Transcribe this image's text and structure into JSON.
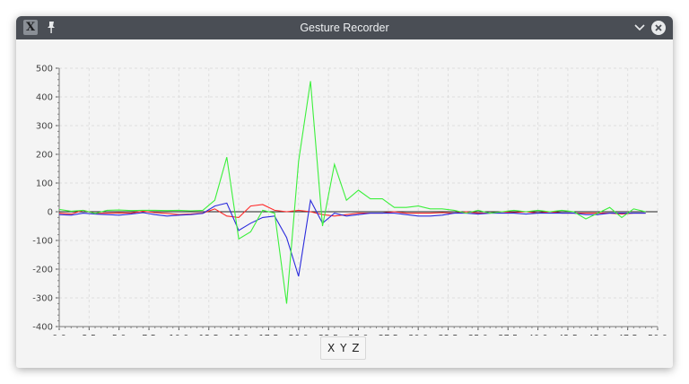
{
  "window": {
    "title": "Gesture Recorder"
  },
  "titlebar_icons": [
    "app-icon",
    "pin-icon",
    "chevron-down-icon",
    "close-icon"
  ],
  "legend": {
    "items": [
      "X",
      "Y",
      "Z"
    ]
  },
  "chart_data": {
    "type": "line",
    "xlim": [
      0,
      50
    ],
    "ylim": [
      -400,
      500
    ],
    "xticks": [
      "0.0",
      "2.5",
      "5.0",
      "7.5",
      "10.0",
      "12.5",
      "15.0",
      "17.5",
      "20.0",
      "22.5",
      "25.0",
      "27.5",
      "30.0",
      "32.5",
      "35.0",
      "37.5",
      "40.0",
      "42.5",
      "45.0",
      "47.5",
      "50.0"
    ],
    "yticks": [
      "500",
      "400",
      "300",
      "200",
      "100",
      "0",
      "-100",
      "-200",
      "-300",
      "-400"
    ],
    "grid": true,
    "series": [
      {
        "name": "X",
        "color": "#ff2a2a",
        "x": [
          0,
          1,
          2,
          3,
          4,
          5,
          6,
          7,
          8,
          9,
          10,
          11,
          12,
          13,
          14,
          15,
          16,
          17,
          18,
          19,
          20,
          21,
          22,
          23,
          24,
          25,
          26,
          27,
          28,
          29,
          30,
          31,
          32,
          33,
          34,
          35,
          36,
          37,
          38,
          39,
          40,
          41,
          42,
          43,
          44,
          45,
          46,
          47,
          48,
          49
        ],
        "y": [
          -5,
          -8,
          5,
          -6,
          -5,
          -4,
          -5,
          2,
          -3,
          -6,
          -10,
          -8,
          -5,
          10,
          -15,
          -20,
          20,
          25,
          5,
          0,
          5,
          0,
          -10,
          -15,
          -10,
          -5,
          -5,
          -5,
          0,
          -5,
          -5,
          -5,
          -3,
          -5,
          0,
          -5,
          -5,
          0,
          -3,
          0,
          -5,
          0,
          -5,
          -5,
          -5,
          -5,
          -5,
          -8,
          -5,
          -5
        ]
      },
      {
        "name": "Y",
        "color": "#2b2bdc",
        "x": [
          0,
          1,
          2,
          3,
          4,
          5,
          6,
          7,
          8,
          9,
          10,
          11,
          12,
          13,
          14,
          15,
          16,
          17,
          18,
          19,
          20,
          21,
          22,
          23,
          24,
          25,
          26,
          27,
          28,
          29,
          30,
          31,
          32,
          33,
          34,
          35,
          36,
          37,
          38,
          39,
          40,
          41,
          42,
          43,
          44,
          45,
          46,
          47,
          48,
          49
        ],
        "y": [
          -10,
          -12,
          -5,
          -8,
          -10,
          -12,
          -8,
          -3,
          -10,
          -15,
          -12,
          -10,
          -6,
          20,
          30,
          -65,
          -40,
          -20,
          -15,
          -90,
          -225,
          40,
          -40,
          -5,
          -15,
          -10,
          -5,
          -5,
          -5,
          -10,
          -15,
          -15,
          -12,
          -5,
          -5,
          -8,
          -5,
          -5,
          -5,
          -8,
          -5,
          -5,
          -5,
          -5,
          -10,
          -10,
          -5,
          -5,
          -5,
          -5
        ]
      },
      {
        "name": "Z",
        "color": "#3cf03c",
        "x": [
          0,
          1,
          2,
          3,
          4,
          5,
          6,
          7,
          8,
          9,
          10,
          11,
          12,
          13,
          14,
          15,
          16,
          17,
          18,
          19,
          20,
          21,
          22,
          23,
          24,
          25,
          26,
          27,
          28,
          29,
          30,
          31,
          32,
          33,
          34,
          35,
          36,
          37,
          38,
          39,
          40,
          41,
          42,
          43,
          44,
          45,
          46,
          47,
          48,
          49
        ],
        "y": [
          8,
          2,
          5,
          -6,
          5,
          6,
          4,
          5,
          5,
          4,
          5,
          3,
          5,
          40,
          190,
          -95,
          -70,
          5,
          -5,
          -320,
          175,
          455,
          -50,
          165,
          40,
          75,
          45,
          45,
          15,
          15,
          20,
          10,
          10,
          5,
          -5,
          5,
          -5,
          0,
          5,
          0,
          5,
          0,
          5,
          0,
          -25,
          -5,
          15,
          -20,
          10,
          0
        ]
      }
    ]
  }
}
